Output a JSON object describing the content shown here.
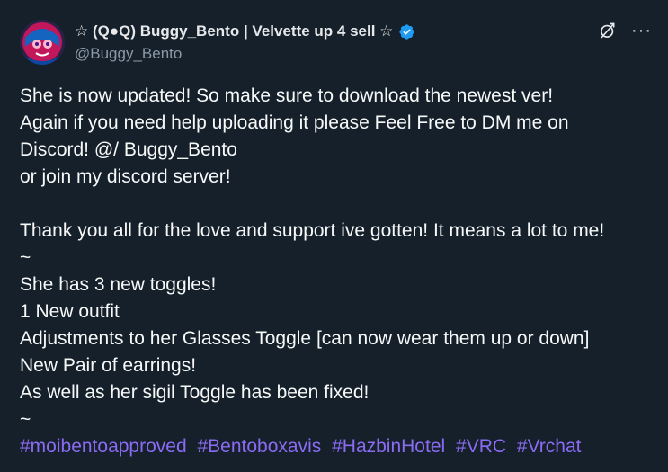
{
  "author": {
    "display_name": "☆ (Q●Q) Buggy_Bento | Velvette up 4 sell ☆",
    "handle": "@Buggy_Bento",
    "verified": true,
    "avatar_icon": "avatar-image",
    "verified_icon": "verified-badge-icon",
    "verified_color": "#1d9bf0"
  },
  "actions": {
    "grok_icon": "grok-icon",
    "more_label": "···"
  },
  "body": {
    "lines": [
      "She is now updated! So make sure to download the newest ver!",
      "Again if you need help uploading it please Feel Free to DM me on",
      "Discord! @/ Buggy_Bento",
      "or join my discord server!",
      "",
      "Thank you all for the love and support ive gotten! It means a lot to me!",
      "~",
      "She has 3 new toggles!",
      "1 New outfit",
      "Adjustments to her Glasses Toggle [can now wear them up or down]",
      "New Pair of earrings!",
      "As well as her sigil Toggle has been fixed!",
      "~"
    ],
    "hashtags": [
      "#moibentoapproved",
      "#Bentoboxavis",
      "#HazbinHotel",
      "#VRC",
      "#Vrchat"
    ]
  },
  "colors": {
    "background": "#15202b",
    "text": "#f7f9f9",
    "secondary_text": "#8b98a5",
    "hashtag": "#8a6bf2"
  }
}
